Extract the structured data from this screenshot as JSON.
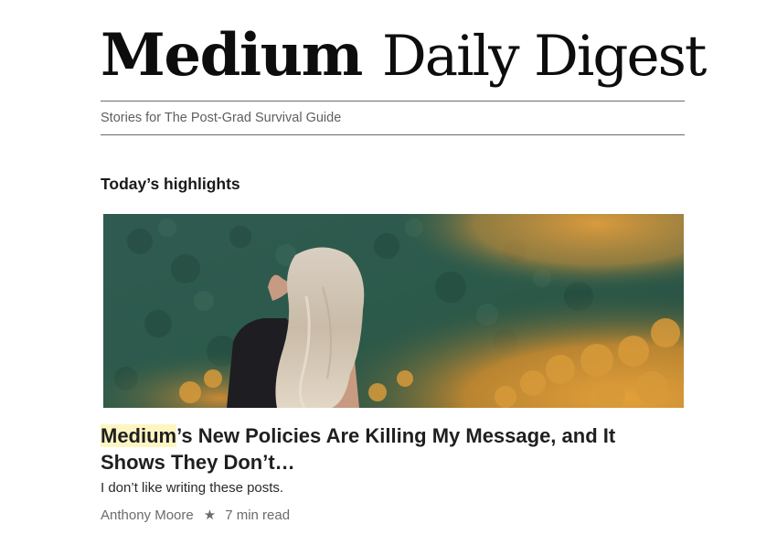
{
  "masthead": {
    "brand": "Medium",
    "title": "Daily Digest"
  },
  "tagline": "Stories for The Post-Grad Survival Guide",
  "section": {
    "heading": "Today’s highlights"
  },
  "article": {
    "image_alt": "woman-with-blonde-hair-overlooking-forest-photo",
    "title_highlight": "Medium",
    "title_rest": "’s New Policies Are Killing My Message, and It Shows They Don’t…",
    "subtitle": "I don’t like writing these posts.",
    "author": "Anthony Moore",
    "separator_icon": "star-icon",
    "read_time": "7 min read"
  },
  "colors": {
    "highlight": "#fdf6c3",
    "rule": "#6b6b6b",
    "meta_text": "#6b6b6b"
  }
}
